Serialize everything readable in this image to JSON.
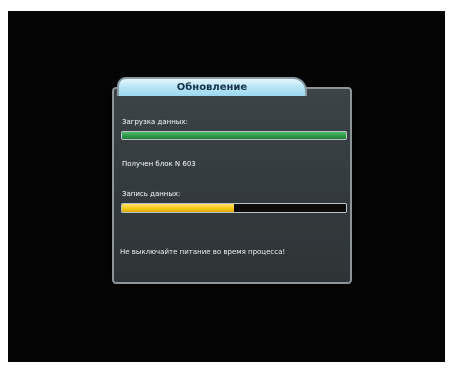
{
  "dialog": {
    "title": "Обновление",
    "download_label": "Загрузка данных:",
    "download_progress": 1.0,
    "received_block": "Получен блок N 603",
    "write_label": "Запись данных:",
    "write_progress": 0.5,
    "warning": "Не выключайте питание во время процесса!"
  },
  "colors": {
    "background": "#050505",
    "tab": "#b8e6f7",
    "download_bar": "#2f9b4b",
    "write_bar": "#f5c918"
  }
}
